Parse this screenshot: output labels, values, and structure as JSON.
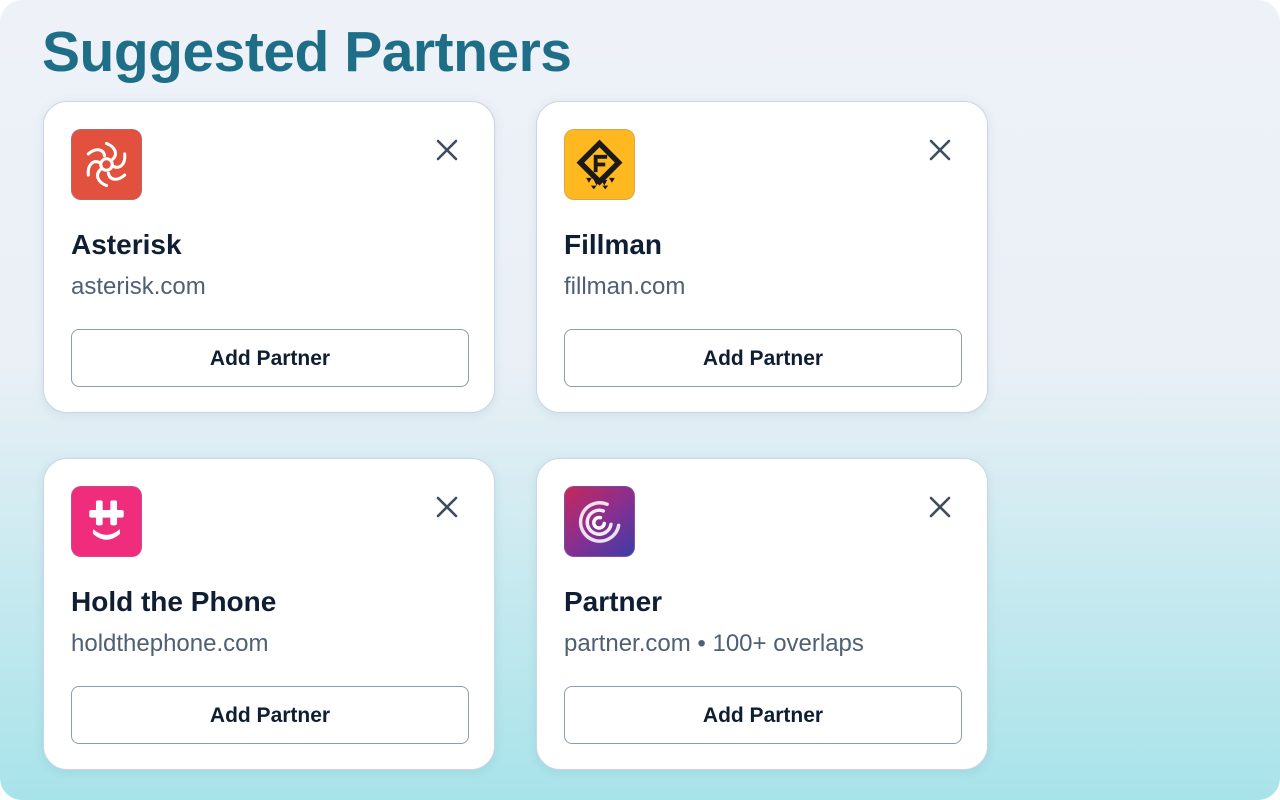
{
  "page": {
    "title": "Suggested Partners"
  },
  "partners": [
    {
      "name": "Asterisk",
      "meta": "asterisk.com",
      "logo_icon": "asterisk-logo-icon",
      "logo_color": "#e2513d",
      "add_label": "Add Partner",
      "dismiss_icon": "close-icon"
    },
    {
      "name": "Fillman",
      "meta": "fillman.com",
      "logo_icon": "fillman-logo-icon",
      "logo_color": "#ffb81f",
      "add_label": "Add Partner",
      "dismiss_icon": "close-icon"
    },
    {
      "name": "Hold the Phone",
      "meta": "holdthephone.com",
      "logo_icon": "hold-the-phone-logo-icon",
      "logo_color": "#f02d7d",
      "add_label": "Add Partner",
      "dismiss_icon": "close-icon"
    },
    {
      "name": "Partner",
      "meta": "partner.com • 100+ overlaps",
      "logo_icon": "partner-logo-icon",
      "logo_color": "#8a2f8f",
      "add_label": "Add Partner",
      "dismiss_icon": "close-icon"
    }
  ],
  "colors": {
    "title": "#1f6e88",
    "text_primary": "#0f1e33",
    "text_secondary": "#4f5f74",
    "card_border": "#c9d6e6",
    "button_border": "#8d9cb0",
    "background_top": "#eef2f8",
    "background_bottom": "#a8e3ea"
  }
}
